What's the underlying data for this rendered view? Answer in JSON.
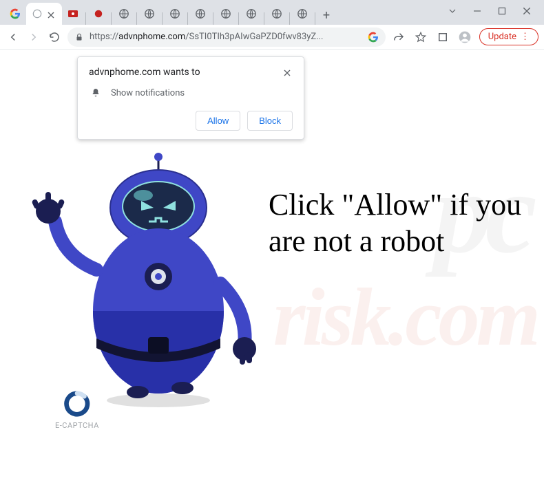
{
  "tabs": {
    "icons": [
      "google",
      "active",
      "record-red",
      "record-dark",
      "globe",
      "globe",
      "globe",
      "globe",
      "globe",
      "globe",
      "globe",
      "globe"
    ]
  },
  "omnibox": {
    "scheme": "https://",
    "host": "advnphome.com",
    "path": "/SsTI0TIh3pAIwGaPZD0fwv83yZ..."
  },
  "toolbar": {
    "update_label": "Update"
  },
  "notification": {
    "origin": "advnphome.com wants to",
    "permission": "Show notifications",
    "allow_label": "Allow",
    "block_label": "Block"
  },
  "page": {
    "headline": "Click \"Allow\" if you are not a robot",
    "captcha_label": "E-CAPTCHA"
  },
  "watermark": {
    "top": "pc",
    "bottom": "risk.com"
  }
}
